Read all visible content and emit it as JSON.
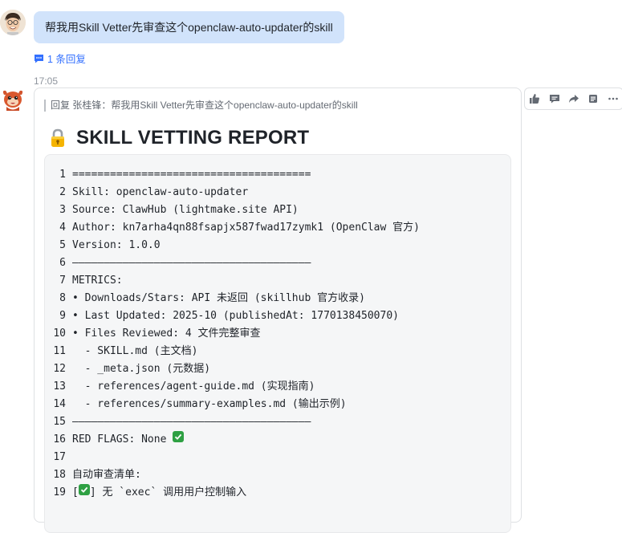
{
  "user_message": {
    "text": "帮我用Skill Vetter先审查这个openclaw-auto-updater的skill",
    "reply_count_label": "1 条回复"
  },
  "bot_message": {
    "time": "17:05",
    "quote": "回复 张桂锋：帮我用Skill Vetter先审查这个openclaw-auto-updater的skill",
    "title_icon": "lock-icon",
    "title": "SKILL VETTING REPORT",
    "code_lines": [
      {
        "n": "1",
        "t": "======================================"
      },
      {
        "n": "2",
        "t": "Skill: openclaw-auto-updater"
      },
      {
        "n": "3",
        "t": "Source: ClawHub (lightmake.site API)"
      },
      {
        "n": "4",
        "t": "Author: kn7arha4qn88fsapjx587fwad17zymk1 (OpenClaw 官方)"
      },
      {
        "n": "5",
        "t": "Version: 1.0.0"
      },
      {
        "n": "6",
        "t": "——————————————————————————————————————"
      },
      {
        "n": "7",
        "t": "METRICS:"
      },
      {
        "n": "8",
        "t": "• Downloads/Stars: API 未返回 (skillhub 官方收录)"
      },
      {
        "n": "9",
        "t": "• Last Updated: 2025-10 (publishedAt: 1770138450070)"
      },
      {
        "n": "10",
        "t": "• Files Reviewed: 4 文件完整审查"
      },
      {
        "n": "11",
        "t": "  - SKILL.md (主文档)"
      },
      {
        "n": "12",
        "t": "  - _meta.json (元数据)"
      },
      {
        "n": "13",
        "t": "  - references/agent-guide.md (实现指南)"
      },
      {
        "n": "14",
        "t": "  - references/summary-examples.md (输出示例)"
      },
      {
        "n": "15",
        "t": "——————————————————————————————————————"
      },
      {
        "n": "16",
        "t": "RED FLAGS: None ",
        "check_after": true
      },
      {
        "n": "17",
        "t": ""
      },
      {
        "n": "18",
        "t": "自动审查清单:"
      },
      {
        "n": "19",
        "t_pre": "[",
        "t": "] 无 `exec` 调用用户控制输入",
        "check_inside": true
      }
    ]
  },
  "toolbar": [
    "thumbs-up-icon",
    "comment-icon",
    "forward-icon",
    "quote-icon",
    "more-icon"
  ]
}
